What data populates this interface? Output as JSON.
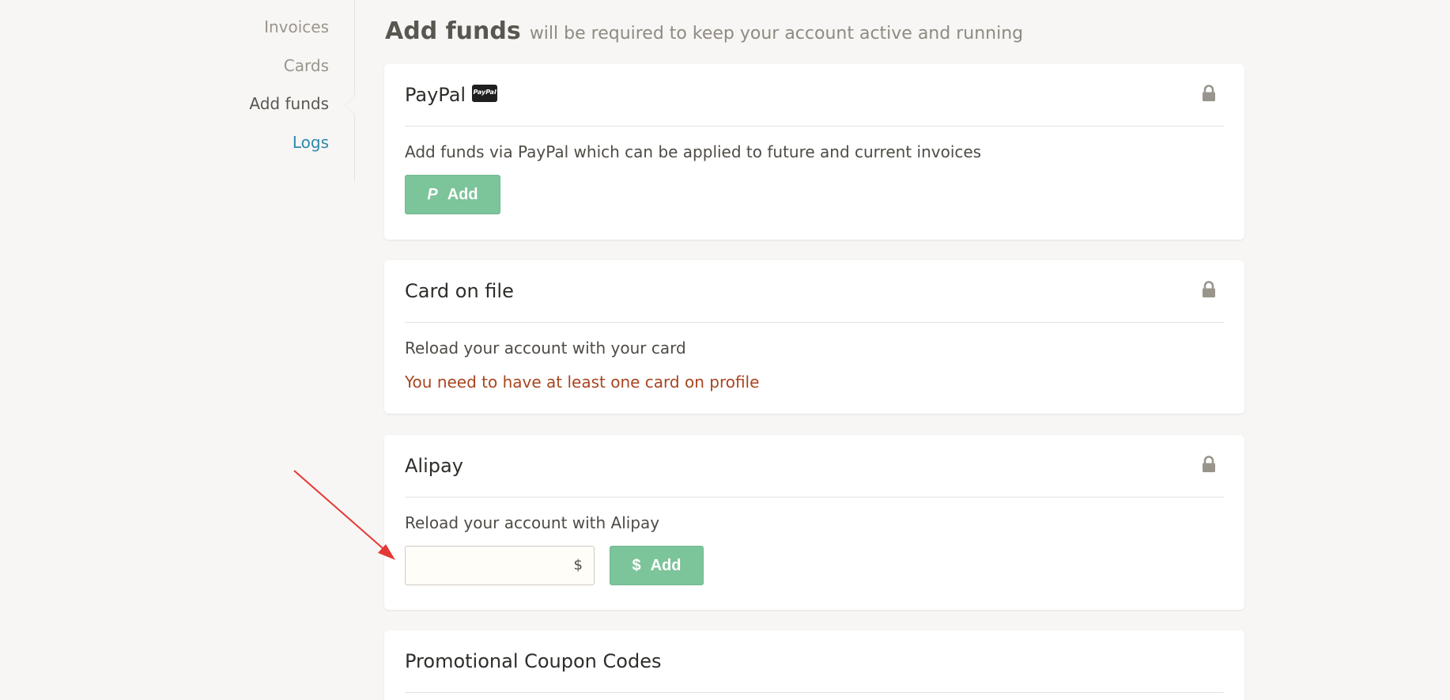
{
  "sidebar": {
    "items": [
      {
        "label": "Invoices"
      },
      {
        "label": "Cards"
      },
      {
        "label": "Add funds"
      },
      {
        "label": "Logs"
      }
    ]
  },
  "header": {
    "title": "Add funds",
    "subtitle": "will be required to keep your account active and running"
  },
  "paypal": {
    "title": "PayPal",
    "badge": "PayPal",
    "description": "Add funds via PayPal which can be applied to future and current invoices",
    "button_label": "Add",
    "button_icon": "P"
  },
  "card_on_file": {
    "title": "Card on file",
    "description": "Reload your account with your card",
    "warning": "You need to have at least one card on profile"
  },
  "alipay": {
    "title": "Alipay",
    "description": "Reload your account with Alipay",
    "amount_value": "",
    "currency_symbol": "$",
    "button_label": "Add",
    "button_icon": "$"
  },
  "coupons": {
    "title": "Promotional Coupon Codes"
  },
  "colors": {
    "accent_green": "#7cc49a",
    "link_blue": "#2d8aa8",
    "warning": "#a9451f",
    "annotation_arrow": "#e53935"
  },
  "icons": {
    "lock": "lock-icon",
    "paypal": "paypal-icon",
    "dollar": "dollar-icon"
  }
}
